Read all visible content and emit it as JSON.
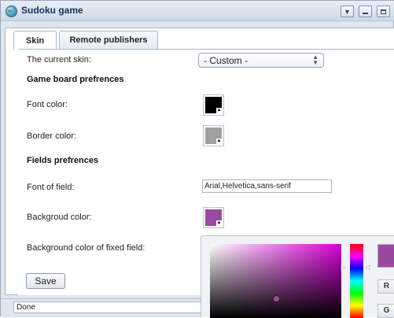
{
  "window": {
    "title": "Sudoku game",
    "controls": [
      "dropdown-icon",
      "minimize-icon",
      "maximize-icon"
    ]
  },
  "tabs": [
    {
      "label": "Skin",
      "active": true
    },
    {
      "label": "Remote publishers",
      "active": false
    }
  ],
  "skin": {
    "current_skin_label": "The current skin:",
    "current_skin_value": "- Custom -",
    "board_header": "Game board prefrences",
    "font_color_label": "Font color:",
    "font_color": "#000000",
    "border_color_label": "Border color:",
    "border_color": "#a0a0a0",
    "fields_header": "Fields prefrences",
    "font_field_label": "Font of field:",
    "font_field_value": "Arial,Helvetica,sans-serif",
    "bg_color_label": "Backgroud color:",
    "bg_color": "#9a4aa0",
    "fixed_bg_label": "Background color of fixed field:",
    "save_label": "Save"
  },
  "status": {
    "text": "Done"
  },
  "color_picker": {
    "current_color": "#9a4aa0",
    "channels": [
      "R",
      "G"
    ]
  }
}
